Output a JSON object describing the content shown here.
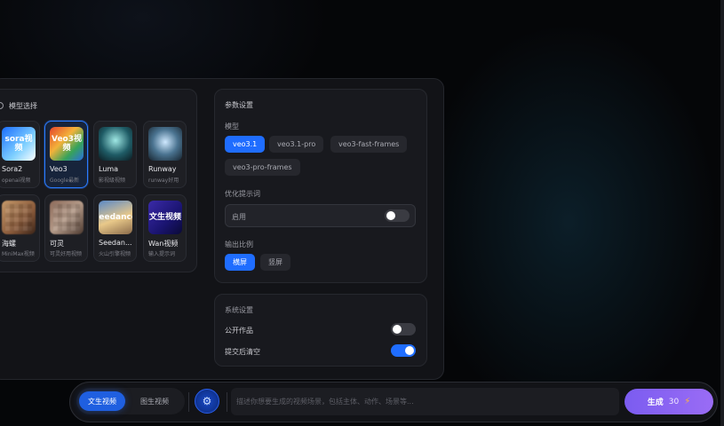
{
  "models": {
    "section_title": "模型选择",
    "items": [
      {
        "name": "Sora2",
        "desc": "openai视频",
        "thumb_text": "sora视频"
      },
      {
        "name": "Veo3",
        "desc": "Google最新",
        "thumb_text": "Veo3视频"
      },
      {
        "name": "Luma",
        "desc": "影视级视频",
        "thumb_text": ""
      },
      {
        "name": "Runway",
        "desc": "runway好用",
        "thumb_text": ""
      },
      {
        "name": "海螺",
        "desc": "MiniMax视频",
        "thumb_text": ""
      },
      {
        "name": "可灵",
        "desc": "可灵好用视频",
        "thumb_text": ""
      },
      {
        "name": "Seedan...",
        "desc": "火山引擎视频",
        "thumb_text": "seedance"
      },
      {
        "name": "Wan视频",
        "desc": "输入提示词",
        "thumb_text": "文生视频"
      }
    ],
    "selected": "Veo3"
  },
  "params": {
    "section_title": "参数设置",
    "model_label": "模型",
    "model_options": [
      "veo3.1",
      "veo3.1-pro",
      "veo3-fast-frames",
      "veo3-pro-frames"
    ],
    "selected_model": "veo3.1",
    "optimize_label": "优化提示词",
    "optimize_field_text": "启用",
    "optimize_enabled": false,
    "ratio_label": "输出比例",
    "ratio_options": [
      "横屏",
      "竖屏"
    ],
    "selected_ratio": "横屏"
  },
  "system": {
    "section_title": "系统设置",
    "public_label": "公开作品",
    "public_enabled": false,
    "clear_label": "提交后清空",
    "clear_enabled": true
  },
  "bottom": {
    "mode_text2video": "文生视频",
    "mode_img2video": "图生视频",
    "active_mode": "文生视频",
    "prompt_placeholder": "描述你想要生成的视频场景，包括主体、动作、场景等...",
    "generate_label": "生成",
    "cost": "30"
  },
  "colors": {
    "accent": "#1f6dff",
    "generate": "#8a64f2"
  }
}
